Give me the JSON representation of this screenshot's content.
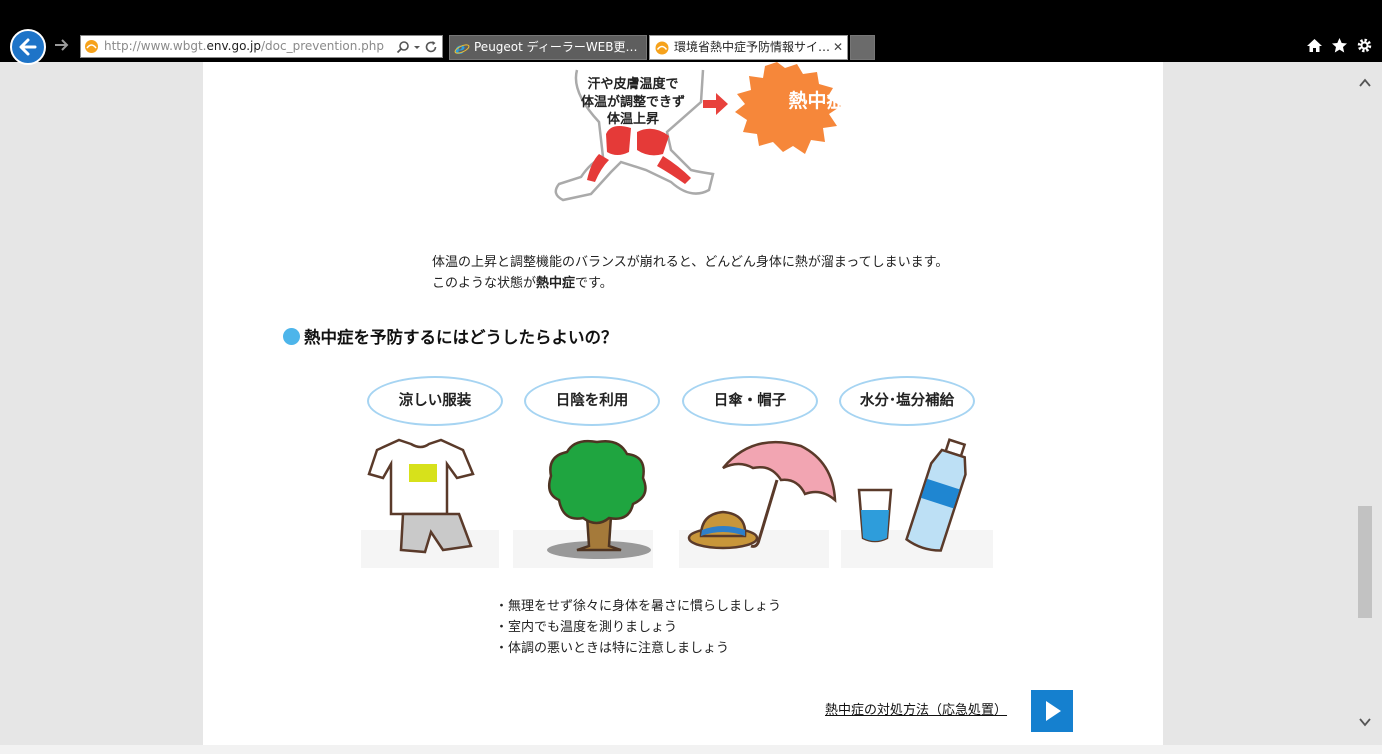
{
  "browser": {
    "address": {
      "prefix": "http://www.wbgt.",
      "domain": "env.go.jp",
      "path": "/doc_prevention.php"
    },
    "tabs": [
      {
        "title": "Peugeot ディーラーWEB更…",
        "active": false
      },
      {
        "title": "環境省熱中症予防情報サイ…",
        "active": true
      }
    ]
  },
  "hero": {
    "caption_lines": [
      "汗や皮膚温度で",
      "体温が調整できず",
      "体温上昇"
    ],
    "burst_label": "熱中症"
  },
  "intro": {
    "line1": "体温の上昇と調整機能のバランスが崩れると、どんどん身体に熱が溜まってしまいます。",
    "line2_pre": "このような状態が",
    "line2_bold": "熱中症",
    "line2_post": "です。"
  },
  "section": {
    "heading": "熱中症を予防するにはどうしたらよいの？"
  },
  "prevention": [
    {
      "label": "涼しい服装",
      "icon": "clothes-icon"
    },
    {
      "label": "日陰を利用",
      "icon": "tree-icon"
    },
    {
      "label": "日傘・帽子",
      "icon": "umbrella-hat-icon"
    },
    {
      "label": "水分･塩分補給",
      "icon": "water-bottle-icon"
    }
  ],
  "tips": [
    "・無理をせず徐々に身体を暑さに慣らしましょう",
    "・室内でも温度を測りましょう",
    "・体調の悪いときは特に注意しましょう"
  ],
  "emergency_link": "熱中症の対処方法（応急処置）",
  "colors": {
    "accent_blue": "#1580cf",
    "heading_dot": "#4db5ea",
    "oval_border": "#a6d4f2",
    "burst_orange": "#f6873a",
    "arrow_red": "#e8413c"
  }
}
